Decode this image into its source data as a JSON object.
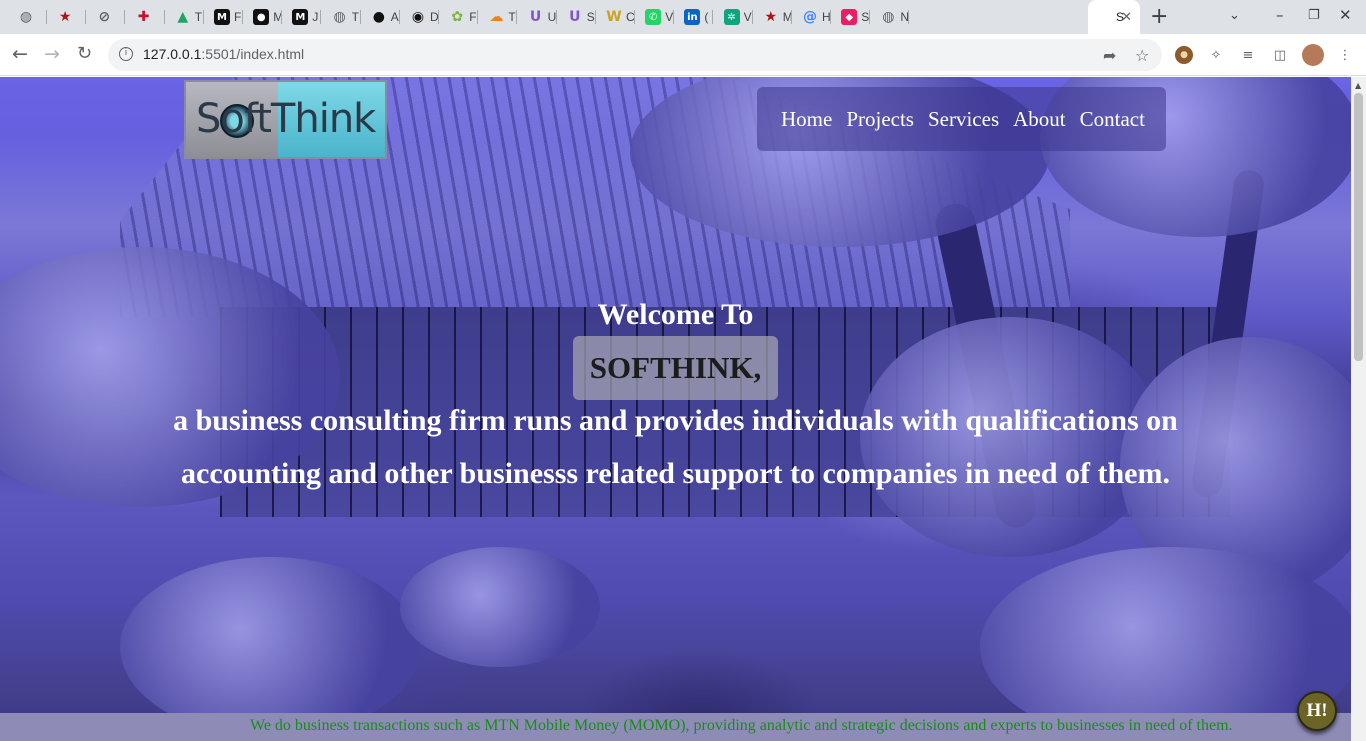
{
  "browser": {
    "tabs": [
      {
        "icon": "globe-icon",
        "color": "#5f6368",
        "label": ""
      },
      {
        "icon": "star-icon",
        "color": "#b31412",
        "label": ""
      },
      {
        "icon": "no-entry-icon",
        "color": "#5f6368",
        "label": ""
      },
      {
        "icon": "flag-icon",
        "color": "#c8102e",
        "label": ""
      },
      {
        "icon": "drive-icon",
        "color": "#1fa463",
        "label": "T"
      },
      {
        "icon": "m-logo-icon",
        "color": "#111111",
        "label": "F"
      },
      {
        "icon": "medium-icon",
        "color": "#111111",
        "label": "M"
      },
      {
        "icon": "m-logo-icon",
        "color": "#111111",
        "label": "J"
      },
      {
        "icon": "globe-icon",
        "color": "#5f6368",
        "label": "T"
      },
      {
        "icon": "github-icon",
        "color": "#111111",
        "label": "A"
      },
      {
        "icon": "circle-icon",
        "color": "#111111",
        "label": "D"
      },
      {
        "icon": "leaf-icon",
        "color": "#7cb342",
        "label": "F"
      },
      {
        "icon": "cloud-icon",
        "color": "#f38020",
        "label": "T"
      },
      {
        "icon": "u-icon",
        "color": "#7e57c2",
        "label": "U"
      },
      {
        "icon": "u-icon",
        "color": "#7e57c2",
        "label": "S"
      },
      {
        "icon": "w-icon",
        "color": "#c9a227",
        "label": "C"
      },
      {
        "icon": "whatsapp-icon",
        "color": "#25d366",
        "label": "V"
      },
      {
        "icon": "linkedin-icon",
        "color": "#0a66c2",
        "label": "("
      },
      {
        "icon": "openai-icon",
        "color": "#10a37f",
        "label": "V"
      },
      {
        "icon": "star-icon",
        "color": "#b31412",
        "label": "M"
      },
      {
        "icon": "at-icon",
        "color": "#4285f4",
        "label": "H"
      },
      {
        "icon": "cube-icon",
        "color": "#e91e63",
        "label": "S"
      },
      {
        "icon": "chrome-icon",
        "color": "#5f6368",
        "label": "N"
      }
    ],
    "active_tab": {
      "label": "S",
      "close": "✕"
    },
    "new_tab": "+",
    "url_host": "127.0.0.1",
    "url_rest": ":5501/index.html"
  },
  "site": {
    "logo_text": "SoftThink",
    "nav": [
      "Home",
      "Projects",
      "Services",
      "About",
      "Contact"
    ],
    "welcome": "Welcome To",
    "brand": "SOFTHINK,",
    "tagline_1": "a business consulting firm runs and provides individuals with qualifications on",
    "tagline_2": "accounting and other businesss related support to companies in need of them.",
    "marquee": "We do business transactions such as MTN Mobile Money (MOMO), providing analytic and strategic decisions and experts to businesses in need of them.",
    "help_button": "H!"
  },
  "colors": {
    "hero_tint": "#6a64e6",
    "marquee_text": "#1a8a1a",
    "help_button": "#6b6426"
  }
}
